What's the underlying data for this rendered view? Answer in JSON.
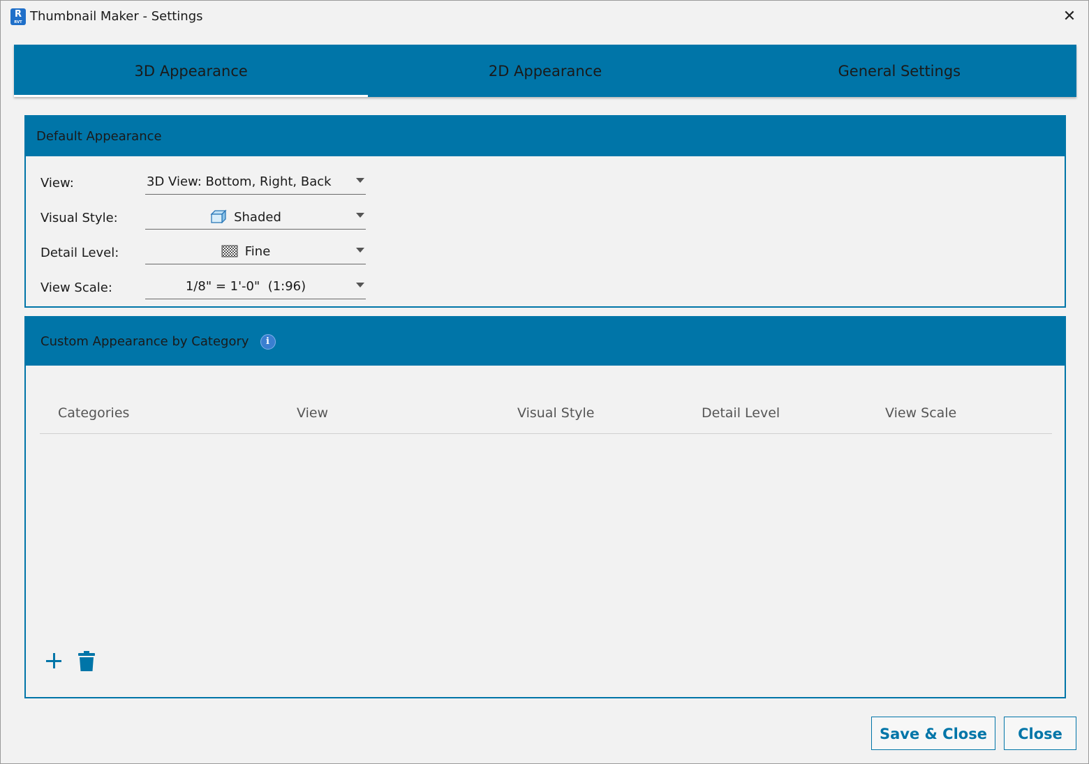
{
  "window": {
    "title": "Thumbnail Maker - Settings",
    "app_icon_letter": "R",
    "app_icon_sub": "RVT",
    "close_glyph": "✕"
  },
  "tabs": [
    {
      "label": "3D Appearance",
      "active": true
    },
    {
      "label": "2D Appearance",
      "active": false
    },
    {
      "label": "General Settings",
      "active": false
    }
  ],
  "default_appearance": {
    "header": "Default Appearance",
    "view": {
      "label": "View:",
      "value": "3D View: Bottom, Right, Back"
    },
    "visual_style": {
      "label": "Visual Style:",
      "value": "Shaded",
      "icon": "shaded-cube-icon"
    },
    "detail_level": {
      "label": "Detail Level:",
      "value": "Fine",
      "icon": "fine-checker-icon"
    },
    "view_scale": {
      "label": "View Scale:",
      "value": "1/8\" = 1'-0\"  (1:96)"
    }
  },
  "custom_appearance": {
    "header": "Custom Appearance by Category",
    "info_glyph": "i",
    "columns": [
      "Categories",
      "View",
      "Visual Style",
      "Detail Level",
      "View Scale"
    ],
    "rows": []
  },
  "buttons": {
    "save_close": "Save & Close",
    "close": "Close"
  },
  "colors": {
    "accent": "#0075a8",
    "background": "#f2f2f2"
  }
}
